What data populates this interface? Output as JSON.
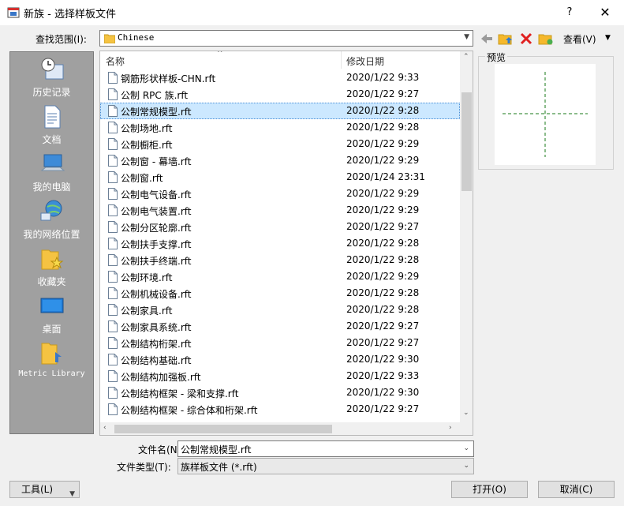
{
  "window": {
    "title": "新族 - 选择样板文件",
    "help": "?",
    "close": "✕"
  },
  "toolbar": {
    "look_in_label": "查找范围(I):",
    "look_in_value": "Chinese",
    "view_label": "查看(V)"
  },
  "places": [
    {
      "label": "历史记录",
      "icon": "history-icon"
    },
    {
      "label": "文档",
      "icon": "document-icon"
    },
    {
      "label": "我的电脑",
      "icon": "computer-icon"
    },
    {
      "label": "我的网络位置",
      "icon": "network-icon"
    },
    {
      "label": "收藏夹",
      "icon": "favorites-icon"
    },
    {
      "label": "桌面",
      "icon": "desktop-icon"
    },
    {
      "label": "Metric Library",
      "icon": "library-folder-icon"
    }
  ],
  "file_list": {
    "col_name": "名称",
    "col_date": "修改日期",
    "rows": [
      {
        "name": "钢筋形状样板-CHN.rft",
        "date": "2020/1/22 9:33"
      },
      {
        "name": "公制 RPC 族.rft",
        "date": "2020/1/22 9:27"
      },
      {
        "name": "公制常规模型.rft",
        "date": "2020/1/22 9:28",
        "selected": true
      },
      {
        "name": "公制场地.rft",
        "date": "2020/1/22 9:28"
      },
      {
        "name": "公制橱柜.rft",
        "date": "2020/1/22 9:29"
      },
      {
        "name": "公制窗 - 幕墙.rft",
        "date": "2020/1/22 9:29"
      },
      {
        "name": "公制窗.rft",
        "date": "2020/1/24 23:31"
      },
      {
        "name": "公制电气设备.rft",
        "date": "2020/1/22 9:29"
      },
      {
        "name": "公制电气装置.rft",
        "date": "2020/1/22 9:29"
      },
      {
        "name": "公制分区轮廓.rft",
        "date": "2020/1/22 9:27"
      },
      {
        "name": "公制扶手支撑.rft",
        "date": "2020/1/22 9:28"
      },
      {
        "name": "公制扶手终端.rft",
        "date": "2020/1/22 9:28"
      },
      {
        "name": "公制环境.rft",
        "date": "2020/1/22 9:29"
      },
      {
        "name": "公制机械设备.rft",
        "date": "2020/1/22 9:28"
      },
      {
        "name": "公制家具.rft",
        "date": "2020/1/22 9:28"
      },
      {
        "name": "公制家具系统.rft",
        "date": "2020/1/22 9:27"
      },
      {
        "name": "公制结构桁架.rft",
        "date": "2020/1/22 9:27"
      },
      {
        "name": "公制结构基础.rft",
        "date": "2020/1/22 9:30"
      },
      {
        "name": "公制结构加强板.rft",
        "date": "2020/1/22 9:33"
      },
      {
        "name": "公制结构框架 - 梁和支撑.rft",
        "date": "2020/1/22 9:30"
      },
      {
        "name": "公制结构框架 - 综合体和桁架.rft",
        "date": "2020/1/22 9:27"
      }
    ]
  },
  "preview": {
    "label": "预览"
  },
  "filename": {
    "label": "文件名(N):",
    "value": "公制常规模型.rft"
  },
  "filetype": {
    "label": "文件类型(T):",
    "value": "族样板文件 (*.rft)"
  },
  "buttons": {
    "tools": "工具(L)",
    "open": "打开(O)",
    "cancel": "取消(C)"
  },
  "colors": {
    "selection": "#cce8ff",
    "places_bg": "#a0a0a0",
    "preview_cross": "#1a7a1a"
  }
}
